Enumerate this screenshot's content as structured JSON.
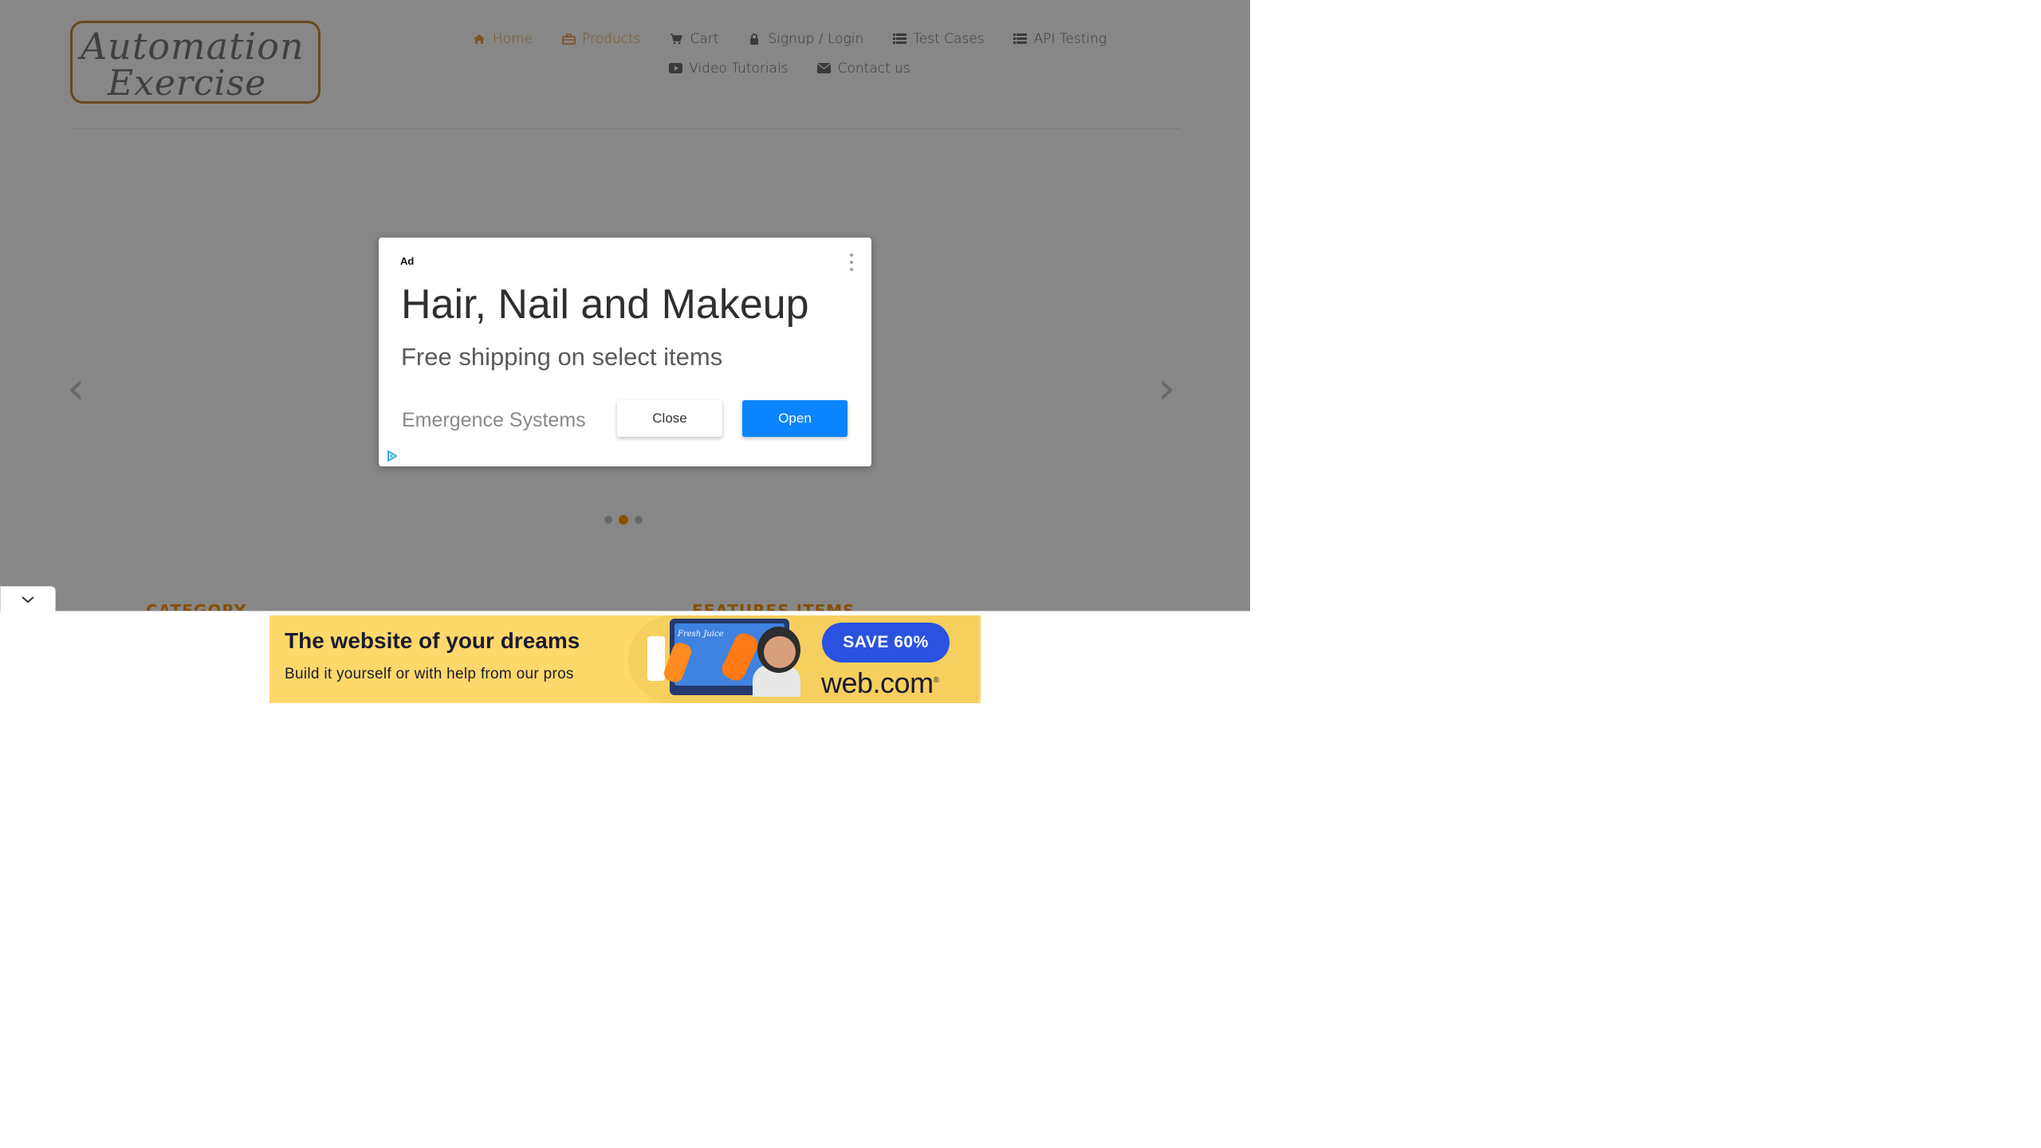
{
  "logo": {
    "line1": "Automation",
    "line2": "Exercise"
  },
  "nav": {
    "row1": [
      {
        "label": "Home",
        "icon": "home-icon",
        "active": true
      },
      {
        "label": "Products",
        "icon": "briefcase-icon",
        "active": true
      },
      {
        "label": "Cart",
        "icon": "cart-icon"
      },
      {
        "label": "Signup / Login",
        "icon": "lock-icon"
      },
      {
        "label": "Test Cases",
        "icon": "list-icon"
      },
      {
        "label": "API Testing",
        "icon": "list-icon"
      }
    ],
    "row2": [
      {
        "label": "Video Tutorials",
        "icon": "youtube-play-icon"
      },
      {
        "label": "Contact us",
        "icon": "envelope-icon"
      }
    ]
  },
  "carousel": {
    "prev_glyph": "‹",
    "next_glyph": "›",
    "active_slide": 2,
    "slide_count": 3
  },
  "sections": {
    "category": "CATEGORY",
    "features": "FEATURES ITEMS"
  },
  "ad": {
    "label": "Ad",
    "title": "Hair, Nail and Makeup",
    "subtitle": "Free shipping on select items",
    "advertiser": "Emergence Systems",
    "close_label": "Close",
    "open_label": "Open",
    "open_color": "#0b84ff"
  },
  "banner": {
    "headline": "The website of your dreams",
    "subline": "Build it yourself or with help from our pros",
    "mockup_text": "Fresh Juice",
    "cta": "SAVE 60%",
    "brand": "web.com",
    "brand_mark": "®"
  },
  "colors": {
    "accent": "#FE980F",
    "overlay": "rgba(0,0,0,0.47)"
  }
}
